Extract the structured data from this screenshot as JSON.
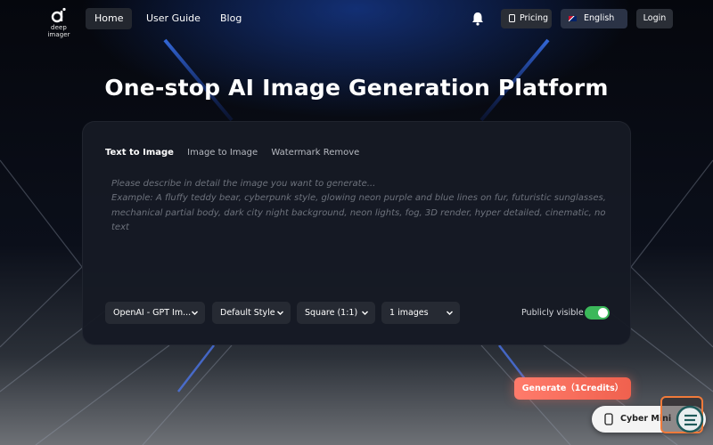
{
  "brand": {
    "logo_text": "deep imager"
  },
  "nav": {
    "links": [
      "Home",
      "User Guide",
      "Blog"
    ],
    "pricing": "Pricing",
    "language": "English",
    "login": "Login"
  },
  "hero": {
    "title": "One-stop AI Image Generation Platform"
  },
  "panel": {
    "tabs": [
      "Text to Image",
      "Image to Image",
      "Watermark Remove"
    ],
    "active_tab": "Text to Image",
    "prompt_value": "",
    "prompt_placeholder": "Please describe in detail the image you want to generate...\nExample: A fluffy teddy bear, cyberpunk style, glowing neon purple and blue lines on fur, futuristic sunglasses, mechanical partial body, dark city night background, neon lights, fog, 3D render, hyper detailed, cinematic, no text",
    "selects": {
      "model": "OpenAI - GPT Im...",
      "style": "Default Style",
      "size": "Square (1:1)",
      "count": "1 images"
    },
    "publicly_visible_label": "Publicly visible",
    "publicly_visible": true
  },
  "generate_label": "Generate（1Credits）",
  "floating": {
    "pill_label": "Cyber Mini"
  },
  "colors": {
    "accent_blue": "#2f6bff",
    "generate": "#f0614e",
    "toggle_on": "#3bb85a",
    "panel_bg": "#161a24"
  },
  "icons": {
    "bell": "bell-icon",
    "pricing": "tag-icon",
    "language": "uk-flag-icon",
    "chevron": "chevron-down-icon",
    "pill": "sparkle-icon",
    "thumb": "chat-icon"
  }
}
